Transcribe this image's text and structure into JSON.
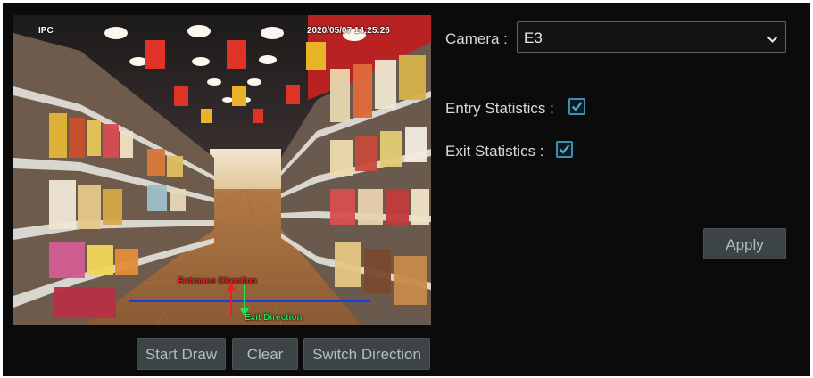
{
  "preview": {
    "channel": "IPC",
    "timestamp": "2020/05/07 14:25:26",
    "entrance_label": "Entrance Direction",
    "exit_label": "Exit Direction"
  },
  "toolbar": {
    "start_draw_label": "Start Draw",
    "clear_label": "Clear",
    "switch_direction_label": "Switch Direction"
  },
  "settings": {
    "camera_label": "Camera :",
    "camera_value": "E3",
    "entry_label": "Entry Statistics :",
    "entry_checked": true,
    "exit_label": "Exit Statistics :",
    "exit_checked": true,
    "apply_label": "Apply"
  },
  "colors": {
    "entrance": "#e8202a",
    "exit": "#27e05a",
    "line": "#1b3fd6",
    "checkbox": "#3d8fb0"
  }
}
